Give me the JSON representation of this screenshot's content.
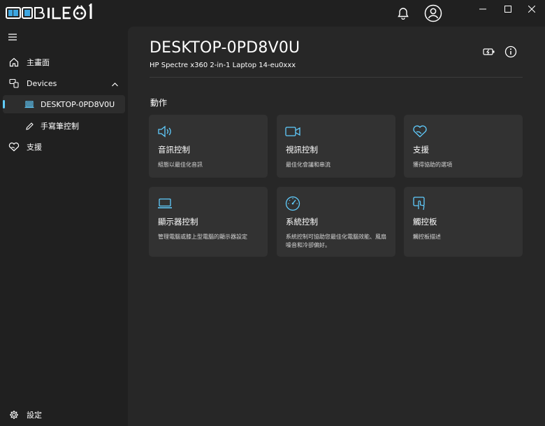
{
  "app": {
    "logo_text": "MOBILE01"
  },
  "sidebar": {
    "items": [
      {
        "label": "主畫面"
      },
      {
        "label": "Devices"
      },
      {
        "label": "DESKTOP-0PD8V0U"
      },
      {
        "label": "手寫筆控制"
      },
      {
        "label": "支援"
      }
    ],
    "settings_label": "設定"
  },
  "main": {
    "device_name": "DESKTOP-0PD8V0U",
    "device_model": "HP Spectre x360 2-in-1 Laptop 14-eu0xxx",
    "section_title": "動作",
    "cards": [
      {
        "title": "音訊控制",
        "desc": "組態以最佳化音訊",
        "icon": "speaker-icon"
      },
      {
        "title": "視訊控制",
        "desc": "最佳化會議和串流",
        "icon": "video-camera-icon"
      },
      {
        "title": "支援",
        "desc": "獲得協助的選項",
        "icon": "heart-hand-icon"
      },
      {
        "title": "顯示器控制",
        "desc": "管理電腦或膝上型電腦的顯示器設定",
        "icon": "laptop-icon"
      },
      {
        "title": "系統控制",
        "desc": "系統控制可協助您最佳化電腦效能、風扇噪音和冷卻偏好。",
        "icon": "gauge-icon"
      },
      {
        "title": "觸控板",
        "desc": "觸控板描述",
        "icon": "touchpad-icon"
      }
    ]
  },
  "colors": {
    "accent": "#60cdff",
    "sidebar_bg": "#202020",
    "main_bg": "#272727",
    "card_bg": "#323232"
  }
}
